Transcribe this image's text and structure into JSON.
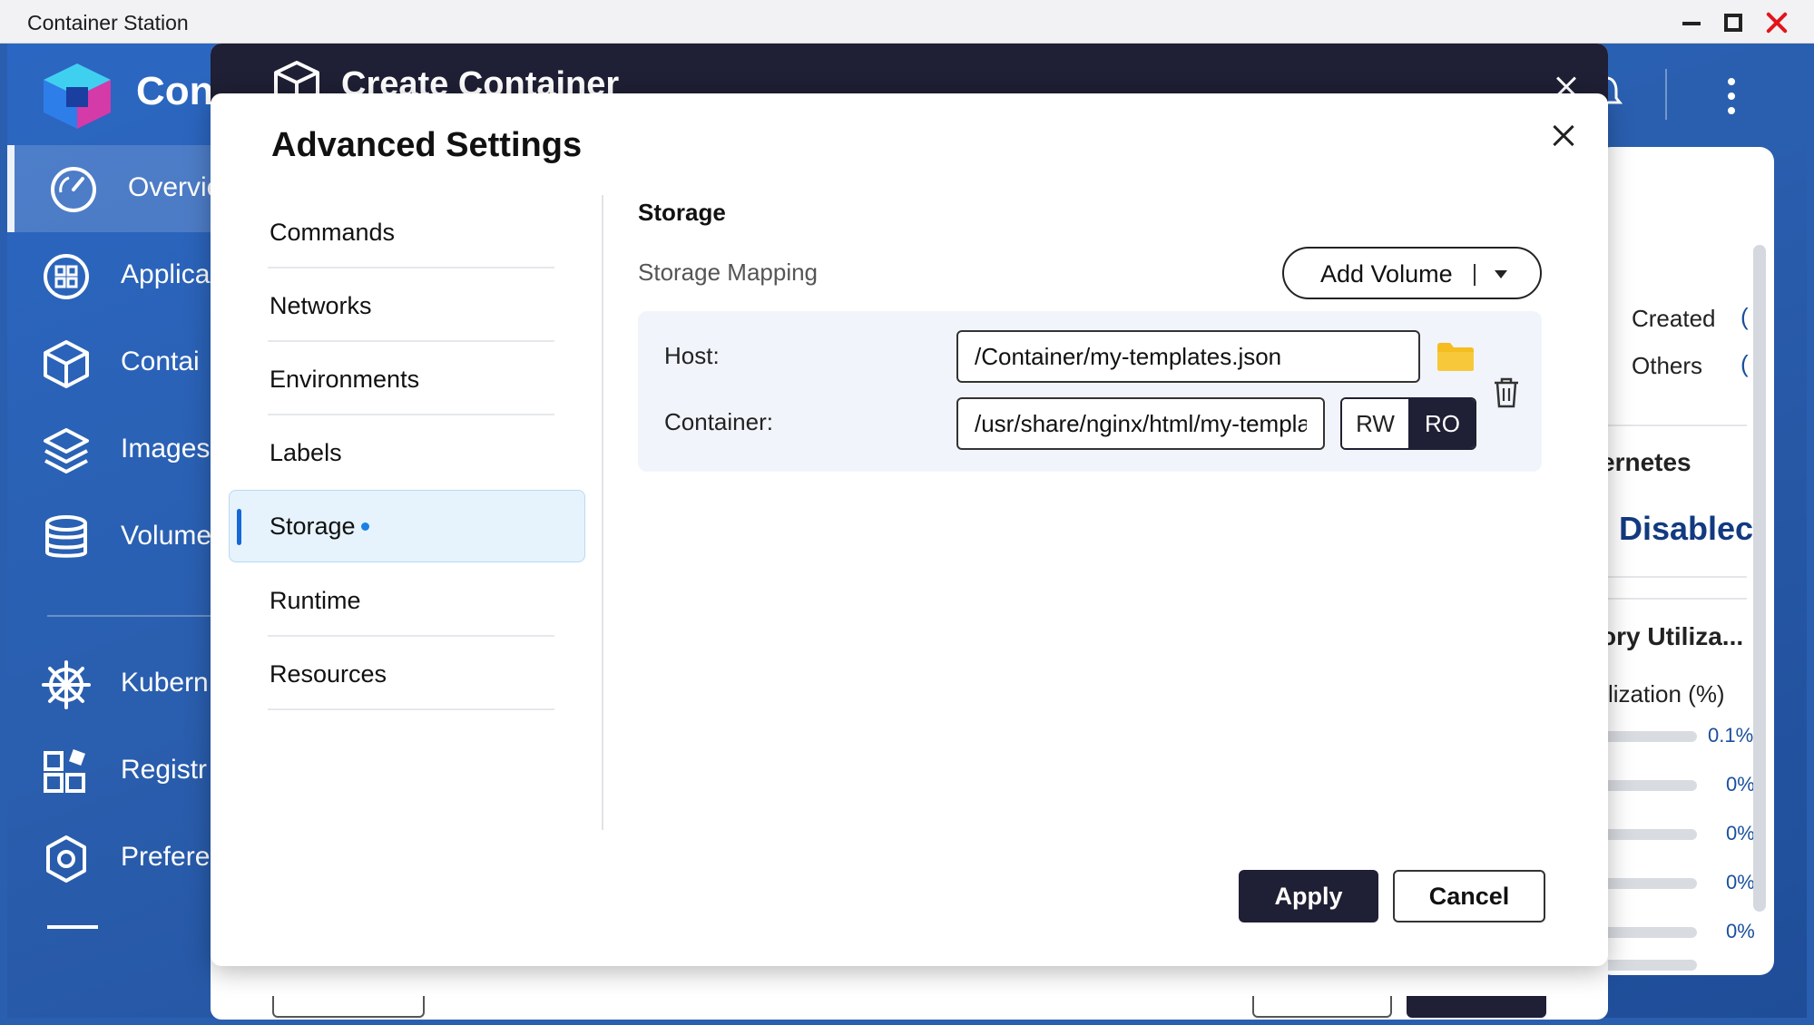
{
  "window": {
    "title": "Container Station"
  },
  "app": {
    "name": "Con"
  },
  "sidebar": {
    "items": [
      {
        "label": "Overvie"
      },
      {
        "label": "Applica"
      },
      {
        "label": "Contai"
      },
      {
        "label": "Images"
      },
      {
        "label": "Volume"
      },
      {
        "label": "Kubern"
      },
      {
        "label": "Registr"
      },
      {
        "label": "Prefere"
      }
    ]
  },
  "create_container": {
    "title": "Create Container"
  },
  "advanced_settings": {
    "title": "Advanced Settings",
    "menu": [
      {
        "label": "Commands"
      },
      {
        "label": "Networks"
      },
      {
        "label": "Environments"
      },
      {
        "label": "Labels"
      },
      {
        "label": "Storage"
      },
      {
        "label": "Runtime"
      },
      {
        "label": "Resources"
      }
    ],
    "storage": {
      "section_title": "Storage",
      "subtitle": "Storage Mapping",
      "add_volume_label": "Add Volume",
      "host_label": "Host:",
      "host_value": "/Container/my-templates.json",
      "container_label": "Container:",
      "container_value": "/usr/share/nginx/html/my-templates.json",
      "rw_label": "RW",
      "ro_label": "RO",
      "selected_mode": "RO"
    },
    "apply_label": "Apply",
    "cancel_label": "Cancel"
  },
  "background_panel": {
    "created_label": "Created",
    "others_label": "Others",
    "kubernetes_label": "ernetes",
    "kubernetes_status": "Disablec",
    "memory_title": "ory Utiliza...",
    "memory_sub": "lization (%)",
    "values": [
      "0.1%",
      "0%",
      "0%",
      "0%",
      "0%"
    ]
  },
  "colors": {
    "accent": "#1668d6",
    "dark": "#1f1f35",
    "sidebar_bg": "#2a5fb0",
    "close_red": "#e0161c",
    "folder": "#f5bd1f"
  }
}
